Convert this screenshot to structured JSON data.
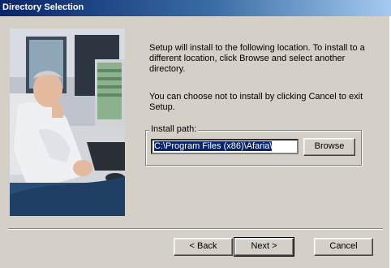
{
  "window": {
    "title": "Directory Selection"
  },
  "message": {
    "line1": "Setup will install to the following location.  To install to a different location, click Browse and select another directory.",
    "line2": "You can choose not to install by clicking Cancel to exit Setup."
  },
  "install_path": {
    "label": "Install path:",
    "value": "C:\\Program Files (x86)\\Afaria\\"
  },
  "buttons": {
    "browse": "Browse",
    "back": "< Back",
    "next": "Next >",
    "cancel": "Cancel"
  }
}
